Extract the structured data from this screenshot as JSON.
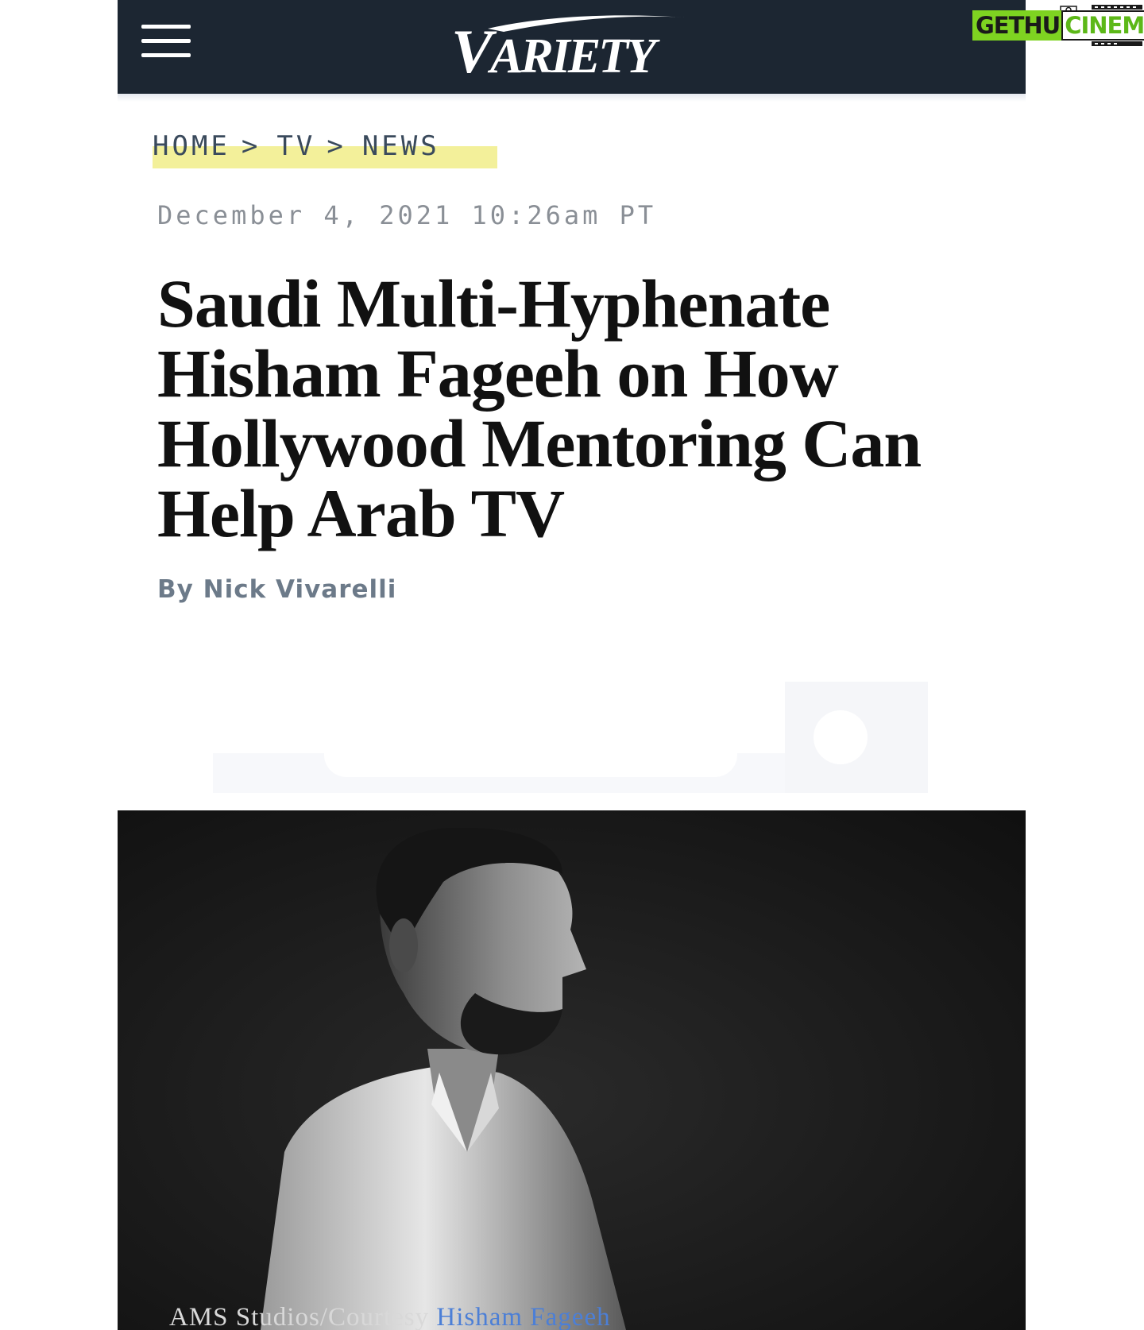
{
  "header": {
    "logo_main": "V",
    "logo_rest": "ARIETY",
    "menu_icon": "hamburger-menu-icon",
    "background": "#1c2632"
  },
  "watermark": {
    "part1": "GETHU",
    "part2": "CINEMA"
  },
  "breadcrumb": {
    "items": [
      "HOME",
      "TV",
      "NEWS"
    ],
    "separator": ">"
  },
  "article": {
    "dateline": "December 4, 2021 10:26am PT",
    "headline": "Saudi Multi-Hyphenate Hisham Fageeh on How Hollywood Mentoring Can Help Arab TV",
    "byline_prefix": "By",
    "author": "Nick Vivarelli"
  },
  "photo": {
    "caption_credit": "AMS Studios/Courtesy ",
    "caption_link": "Hisham Fageeh"
  },
  "colors": {
    "breadcrumb_highlight": "#f3f09a",
    "caption_link": "#4c7fd6",
    "watermark_green": "#7ed321"
  }
}
